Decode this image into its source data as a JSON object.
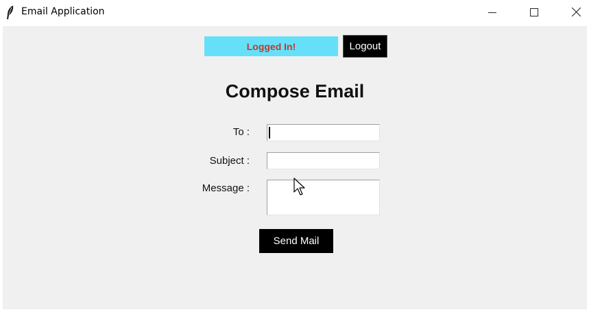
{
  "window": {
    "title": "Email Application",
    "icon": "feather-icon",
    "controls": [
      "minimize-icon",
      "maximize-icon",
      "close-icon"
    ]
  },
  "header": {
    "status": "Logged In!",
    "logout_label": "Logout"
  },
  "form": {
    "heading": "Compose Email",
    "to_label": "To :",
    "to_value": "",
    "subject_label": "Subject :",
    "subject_value": "",
    "message_label": "Message :",
    "message_value": "",
    "send_label": "Send Mail"
  },
  "colors": {
    "status_bg": "#66e0f8",
    "status_text": "#c0392b",
    "button_bg": "#000000",
    "client_bg": "#f0f0f0"
  }
}
